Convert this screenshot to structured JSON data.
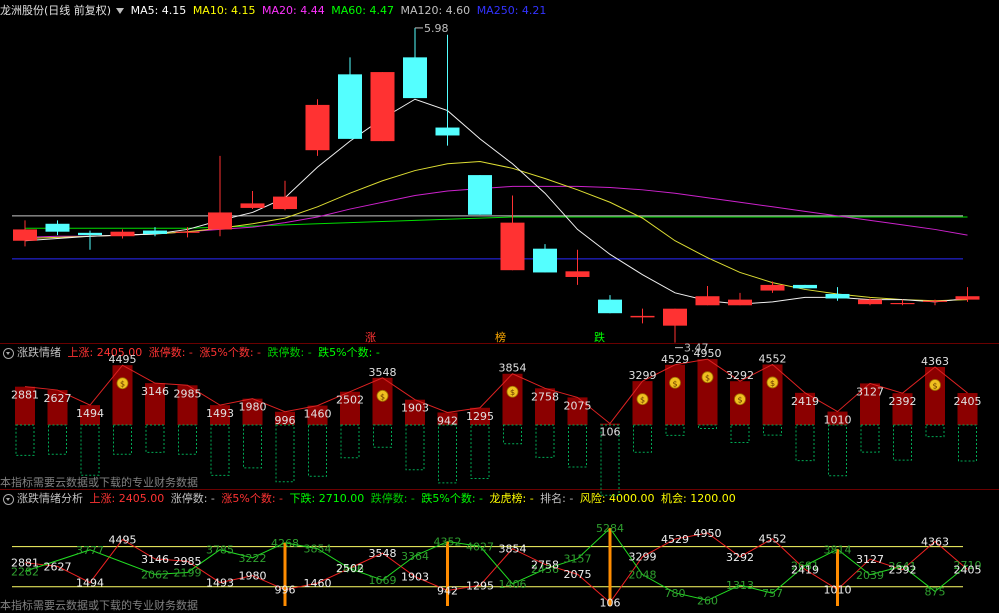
{
  "main_header": {
    "stock": "龙洲股份(日线 前复权)",
    "ma": [
      {
        "label": "MA5: 4.15",
        "color": "#ffffff"
      },
      {
        "label": "MA10: 4.15",
        "color": "#ffff00"
      },
      {
        "label": "MA20: 4.44",
        "color": "#ff33ff"
      },
      {
        "label": "MA60: 4.47",
        "color": "#00ff00"
      },
      {
        "label": "MA120: 4.60",
        "color": "#c0c0c0"
      },
      {
        "label": "MA250: 4.21",
        "color": "#3333ff"
      }
    ]
  },
  "price_marks": {
    "high": "5.98",
    "low": "3.47"
  },
  "bottom_tags": [
    {
      "text": "涨",
      "color": "#ff3333"
    },
    {
      "text": "榜",
      "color": "#ffaa00"
    },
    {
      "text": "跌",
      "color": "#00ff00"
    }
  ],
  "panel2": {
    "title": "涨跌情绪",
    "items": [
      {
        "label": "上涨: 2405.00",
        "color": "#ff3333"
      },
      {
        "label": "涨停数: -",
        "color": "#ff3333"
      },
      {
        "label": "涨5%个数: -",
        "color": "#ff3333"
      },
      {
        "label": "跌停数: -",
        "color": "#00cc00"
      },
      {
        "label": "跌5%个数: -",
        "color": "#00ff00"
      }
    ],
    "values": [
      2881,
      2627,
      1494,
      4495,
      3146,
      2985,
      1493,
      1980,
      996,
      1460,
      2502,
      3548,
      1903,
      942,
      1295,
      3854,
      2758,
      2075,
      106,
      3299,
      4529,
      4950,
      3292,
      4552,
      2419,
      1010,
      3127,
      2392,
      4363,
      2405
    ],
    "money": [
      3,
      11,
      15,
      19,
      20,
      21,
      22,
      23,
      28
    ],
    "note": "本指标需要云数据或下载的专业财务数据"
  },
  "panel3": {
    "title": "涨跌情绪分析",
    "items": [
      {
        "label": "上涨: 2405.00",
        "color": "#ff3333"
      },
      {
        "label": "涨停数: -",
        "color": "#c0c0c0"
      },
      {
        "label": "涨5%个数: -",
        "color": "#ff3333"
      },
      {
        "label": "下跌: 2710.00",
        "color": "#00ff00"
      },
      {
        "label": "跌停数: -",
        "color": "#00cc00"
      },
      {
        "label": "跌5%个数: -",
        "color": "#00ff00"
      },
      {
        "label": "龙虎榜: -",
        "color": "#ffff00"
      },
      {
        "label": "排名: -",
        "color": "#c0c0c0"
      },
      {
        "label": "风险: 4000.00",
        "color": "#ffff00"
      },
      {
        "label": "机会: 1200.00",
        "color": "#ffff00"
      }
    ],
    "up": [
      2881,
      2627,
      1494,
      4495,
      3146,
      2985,
      1493,
      1980,
      996,
      1460,
      2502,
      3548,
      1903,
      942,
      1295,
      3854,
      2758,
      2075,
      106,
      3299,
      4529,
      4950,
      3292,
      4552,
      2419,
      1010,
      3127,
      2392,
      4363,
      2405
    ],
    "down": [
      2282,
      null,
      3777,
      null,
      2062,
      2199,
      3785,
      3222,
      4268,
      3854,
      2466,
      1669,
      3364,
      4352,
      4027,
      1406,
      2436,
      3157,
      5284,
      2048,
      780,
      260,
      1313,
      757,
      2681,
      3814,
      2039,
      2641,
      875,
      2710
    ],
    "spikes": [
      8,
      13,
      18,
      25
    ],
    "note": "本指标需要云数据或下载的专业财务数据"
  },
  "chart_data": {
    "type": "candlestick",
    "title": "龙洲股份(日线 前复权)",
    "candles": [
      {
        "o": 4.2,
        "c": 4.1,
        "h": 4.28,
        "l": 4.05,
        "up": false
      },
      {
        "o": 4.18,
        "c": 4.25,
        "h": 4.28,
        "l": 4.15,
        "up": true
      },
      {
        "o": 4.17,
        "c": 4.15,
        "h": 4.19,
        "l": 4.02,
        "up": true
      },
      {
        "o": 4.18,
        "c": 4.14,
        "h": 4.2,
        "l": 4.12,
        "up": false
      },
      {
        "o": 4.16,
        "c": 4.19,
        "h": 4.22,
        "l": 4.14,
        "up": true
      },
      {
        "o": 4.18,
        "c": 4.17,
        "h": 4.22,
        "l": 4.13,
        "up": false
      },
      {
        "o": 4.2,
        "c": 4.35,
        "h": 4.85,
        "l": 4.14,
        "up": false
      },
      {
        "o": 4.39,
        "c": 4.43,
        "h": 4.54,
        "l": 4.38,
        "up": false
      },
      {
        "o": 4.38,
        "c": 4.49,
        "h": 4.63,
        "l": 4.37,
        "up": false
      },
      {
        "o": 4.9,
        "c": 5.3,
        "h": 5.35,
        "l": 4.85,
        "up": false
      },
      {
        "o": 5.0,
        "c": 5.57,
        "h": 5.72,
        "l": 5.0,
        "up": true
      },
      {
        "o": 5.59,
        "c": 4.98,
        "h": 5.59,
        "l": 4.98,
        "up": false
      },
      {
        "o": 5.36,
        "c": 5.72,
        "h": 5.98,
        "l": 5.36,
        "up": true
      },
      {
        "o": 5.1,
        "c": 5.03,
        "h": 5.92,
        "l": 4.94,
        "up": true
      },
      {
        "o": 4.68,
        "c": 4.33,
        "h": 4.68,
        "l": 4.33,
        "up": true
      },
      {
        "o": 4.26,
        "c": 3.84,
        "h": 4.5,
        "l": 3.84,
        "up": false
      },
      {
        "o": 4.03,
        "c": 3.82,
        "h": 4.07,
        "l": 3.82,
        "up": true
      },
      {
        "o": 3.83,
        "c": 3.78,
        "h": 4.02,
        "l": 3.71,
        "up": false
      },
      {
        "o": 3.46,
        "c": 3.58,
        "h": 3.62,
        "l": 3.46,
        "up": true
      },
      {
        "o": 3.43,
        "c": 3.43,
        "h": 3.5,
        "l": 3.37,
        "up": false
      },
      {
        "o": 3.35,
        "c": 3.5,
        "h": 3.5,
        "l": 3.2,
        "up": false
      },
      {
        "o": 3.61,
        "c": 3.53,
        "h": 3.7,
        "l": 3.53,
        "up": false
      },
      {
        "o": 3.58,
        "c": 3.53,
        "h": 3.64,
        "l": 3.53,
        "up": false
      },
      {
        "o": 3.66,
        "c": 3.71,
        "h": 3.74,
        "l": 3.64,
        "up": false
      },
      {
        "o": 3.71,
        "c": 3.68,
        "h": 3.71,
        "l": 3.68,
        "up": true
      },
      {
        "o": 3.63,
        "c": 3.59,
        "h": 3.69,
        "l": 3.57,
        "up": true
      },
      {
        "o": 3.58,
        "c": 3.54,
        "h": 3.59,
        "l": 3.53,
        "up": false
      },
      {
        "o": 3.55,
        "c": 3.54,
        "h": 3.58,
        "l": 3.53,
        "up": false
      },
      {
        "o": 3.57,
        "c": 3.56,
        "h": 3.58,
        "l": 3.53,
        "up": false
      },
      {
        "o": 3.61,
        "c": 3.58,
        "h": 3.69,
        "l": 3.56,
        "up": false
      }
    ],
    "ma5": [
      4.1,
      4.12,
      4.14,
      4.15,
      4.16,
      4.2,
      4.28,
      4.35,
      4.48,
      4.75,
      4.98,
      5.18,
      5.35,
      5.25,
      5.0,
      4.78,
      4.52,
      4.2,
      3.98,
      3.8,
      3.64,
      3.57,
      3.54,
      3.56,
      3.6,
      3.6,
      3.58,
      3.58,
      3.56,
      3.59
    ],
    "ma10": [
      4.12,
      4.13,
      4.14,
      4.15,
      4.16,
      4.18,
      4.21,
      4.25,
      4.3,
      4.4,
      4.52,
      4.63,
      4.72,
      4.78,
      4.8,
      4.74,
      4.65,
      4.55,
      4.44,
      4.3,
      4.1,
      3.95,
      3.82,
      3.73,
      3.67,
      3.63,
      3.6,
      3.58,
      3.57,
      3.58
    ],
    "ma20": [
      4.13,
      4.14,
      4.14,
      4.15,
      4.16,
      4.18,
      4.2,
      4.22,
      4.26,
      4.31,
      4.38,
      4.44,
      4.5,
      4.54,
      4.56,
      4.58,
      4.58,
      4.58,
      4.57,
      4.55,
      4.52,
      4.48,
      4.44,
      4.4,
      4.36,
      4.32,
      4.28,
      4.24,
      4.2,
      4.15
    ],
    "ma60": [
      4.21,
      4.21,
      4.21,
      4.21,
      4.21,
      4.21,
      4.22,
      4.23,
      4.24,
      4.25,
      4.26,
      4.27,
      4.28,
      4.29,
      4.3,
      4.31,
      4.31,
      4.31,
      4.31,
      4.31,
      4.31,
      4.31,
      4.31,
      4.31,
      4.31,
      4.31,
      4.31,
      4.31,
      4.31,
      4.31
    ],
    "ma120": 4.32,
    "ma250": 3.94,
    "ylim": [
      3.4,
      6.05
    ]
  }
}
